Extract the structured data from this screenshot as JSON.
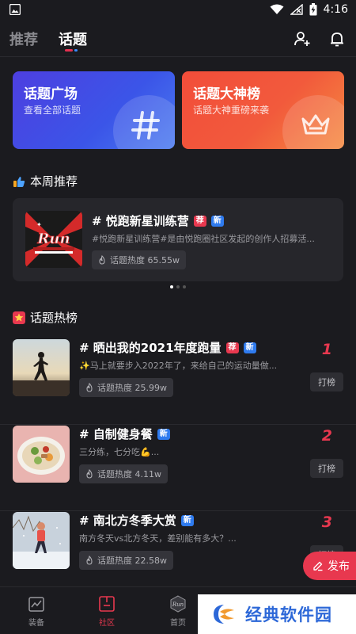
{
  "status_bar": {
    "time": "4:16"
  },
  "nav": {
    "tabs": [
      {
        "label": "推荐"
      },
      {
        "label": "话题"
      }
    ],
    "active_tab": "话题"
  },
  "cards": [
    {
      "title": "话题广场",
      "subtitle": "查看全部话题"
    },
    {
      "title": "话题大神榜",
      "subtitle": "话题大神重磅来袭"
    }
  ],
  "weekly": {
    "heading": "本周推荐",
    "title": "# 悦跑新星训练营",
    "badges": [
      "荐",
      "新"
    ],
    "description": "#悦跑新星训练营#是由悦跑圈社区发起的创作人招募活...",
    "heat_label": "话题热度 65.55w",
    "thumb_text": "Run"
  },
  "hot": {
    "heading": "话题热榜",
    "action_label": "打榜",
    "items": [
      {
        "rank": "1",
        "title": "# 晒出我的2021年度跑量",
        "badges": [
          "荐",
          "新"
        ],
        "description": "✨马上就要步入2022年了，来给自己的运动量做...",
        "heat": "话题热度 25.99w"
      },
      {
        "rank": "2",
        "title": "# 自制健身餐",
        "badges": [
          "新"
        ],
        "description": "三分练，七分吃💪...",
        "heat": "话题热度 4.11w"
      },
      {
        "rank": "3",
        "title": "# 南北方冬季大赏",
        "badges": [
          "新"
        ],
        "description": "南方冬天vs北方冬天，差别能有多大？...",
        "heat": "话题热度 22.58w"
      }
    ]
  },
  "fab": {
    "label": "发布"
  },
  "bottom_nav": [
    {
      "label": "装备"
    },
    {
      "label": "社区"
    },
    {
      "label": "首页"
    }
  ],
  "watermark": {
    "text": "经典软件园"
  },
  "colors": {
    "accent": "#e8384f",
    "new_badge": "#2f7bef",
    "background": "#1b1b1f"
  }
}
